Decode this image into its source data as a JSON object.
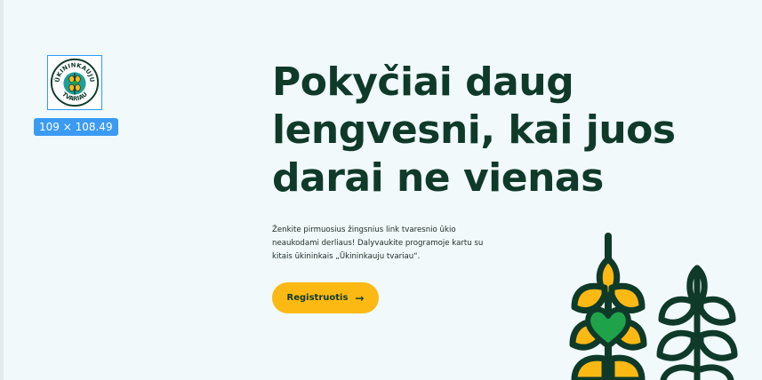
{
  "logo": {
    "top_text": "ŪKININKAUJU",
    "bottom_text": "TVARIAU",
    "dimension_badge": "109 × 108.49"
  },
  "hero": {
    "headline": [
      "Pokyčiai daug",
      "lengvesni, kai juos",
      "darai ne vienas"
    ],
    "description": [
      "Ženkite pirmuosius žingsnius link tvaresnio ūkio",
      "neaukodami derliaus! Dalyvaukite programoje kartu su",
      "kitais ūkininkais „Ūkininkauju tvariau“."
    ],
    "cta_label": "Registruotis",
    "cta_arrow": "→"
  },
  "colors": {
    "background": "#f1f9fa",
    "heading": "#0f3a2a",
    "accent": "#fdb913",
    "heart": "#1fa34a",
    "selection": "#2d9cff"
  },
  "icons": [
    "wheat-heart-icon",
    "wheat-outline-icon",
    "arrow-right-icon"
  ]
}
